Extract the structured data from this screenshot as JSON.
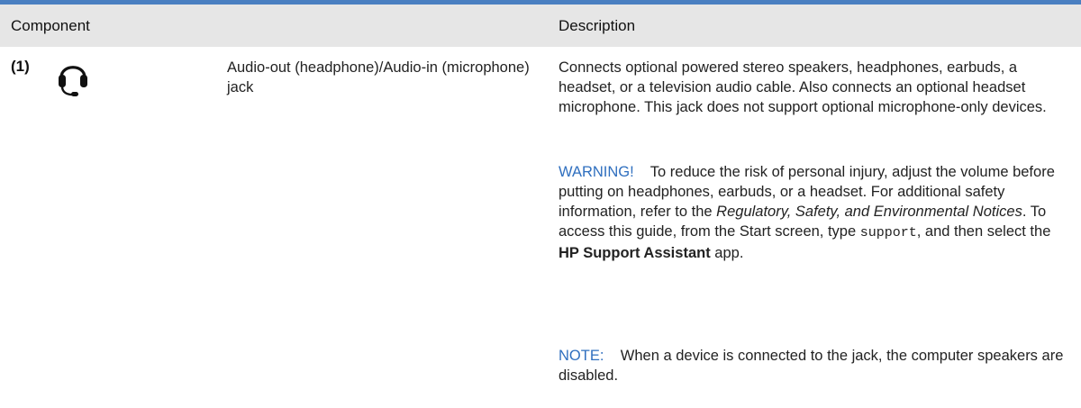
{
  "table": {
    "header": {
      "component": "Component",
      "description": "Description"
    },
    "row": {
      "number": "(1)",
      "icon": "headphone-icon",
      "component_name": "Audio-out (headphone)/Audio-in (microphone) jack",
      "description": "Connects optional powered stereo speakers, headphones, earbuds, a headset, or a television audio cable. Also connects an optional headset microphone. This jack does not support optional microphone-only devices.",
      "warning": {
        "label": "WARNING!",
        "text_1": "To reduce the risk of personal injury, adjust the volume before putting on headphones, earbuds, or a headset. For additional safety information, refer to the ",
        "doc_title": "Regulatory, Safety, and Environmental Notices",
        "text_2": ". To access this guide, from the Start screen, type ",
        "command": "support",
        "text_3": ", and then select the ",
        "app_name": "HP Support Assistant",
        "text_4": " app."
      },
      "note": {
        "label": "NOTE:",
        "text": "When a device is connected to the jack, the computer speakers are disabled."
      }
    }
  },
  "colors": {
    "accent_rule": "#4a7fc1",
    "header_bg": "#e6e6e6",
    "label_blue": "#2f6fbf"
  }
}
